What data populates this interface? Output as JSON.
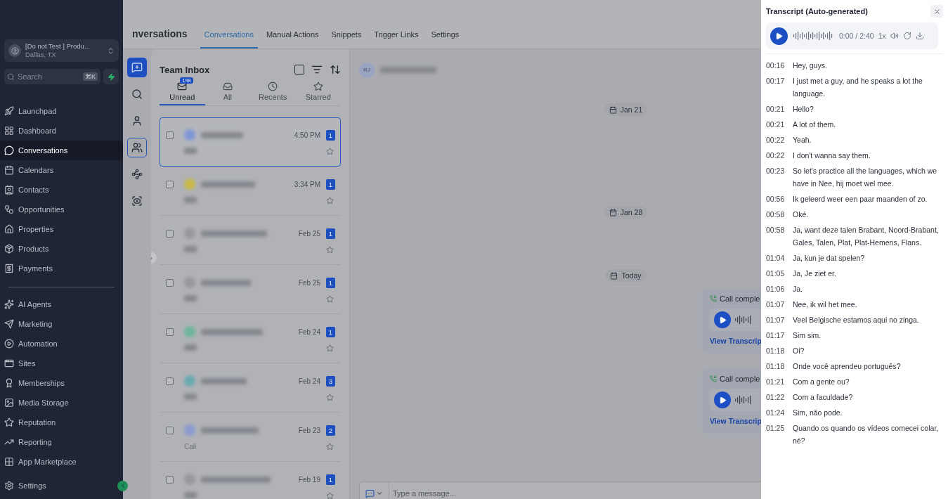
{
  "sidebar": {
    "account": {
      "name": "[Do not Test ] Produ...",
      "location": "Dallas, TX"
    },
    "search": {
      "placeholder": "Search",
      "shortcut": "⌘K"
    },
    "items": [
      {
        "label": "Launchpad",
        "selected": false
      },
      {
        "label": "Dashboard",
        "selected": false
      },
      {
        "label": "Conversations",
        "selected": true
      },
      {
        "label": "Calendars",
        "selected": false
      },
      {
        "label": "Contacts",
        "selected": false
      },
      {
        "label": "Opportunities",
        "selected": false
      },
      {
        "label": "Properties",
        "selected": false
      },
      {
        "label": "Products",
        "selected": false
      },
      {
        "label": "Payments",
        "selected": false
      }
    ],
    "items2": [
      {
        "label": "AI Agents",
        "selected": false
      },
      {
        "label": "Marketing",
        "selected": false
      },
      {
        "label": "Automation",
        "selected": false
      },
      {
        "label": "Sites",
        "selected": false
      },
      {
        "label": "Memberships",
        "selected": false
      },
      {
        "label": "Media Storage",
        "selected": false
      },
      {
        "label": "Reputation",
        "selected": false
      },
      {
        "label": "Reporting",
        "selected": false
      },
      {
        "label": "App Marketplace",
        "selected": false
      }
    ],
    "settings": "Settings"
  },
  "header": {
    "title": "nversations",
    "tabs": [
      {
        "label": "Conversations",
        "selected": true
      },
      {
        "label": "Manual Actions",
        "selected": false
      },
      {
        "label": "Snippets",
        "selected": false
      },
      {
        "label": "Trigger Links",
        "selected": false
      },
      {
        "label": "Settings",
        "selected": false
      }
    ]
  },
  "rail": [
    {
      "selected": false,
      "kind": "primary"
    },
    {
      "selected": false,
      "kind": "plain"
    },
    {
      "selected": false,
      "kind": "plain"
    },
    {
      "selected": true,
      "kind": "plain"
    },
    {
      "selected": false,
      "kind": "plain"
    },
    {
      "selected": false,
      "kind": "plain"
    }
  ],
  "inbox": {
    "title": "Team Inbox",
    "select_all_checked": false,
    "filters": [
      {
        "label": "Unread",
        "badge": "198",
        "selected": true
      },
      {
        "label": "All",
        "selected": false
      },
      {
        "label": "Recents",
        "selected": false
      },
      {
        "label": "Starred",
        "selected": false
      }
    ],
    "rows": [
      {
        "time": "4:50 PM",
        "count": "1",
        "selected": true,
        "color": "#7f97d6"
      },
      {
        "time": "3:34 PM",
        "count": "1",
        "selected": false,
        "color": "#c9b94a"
      },
      {
        "time": "Feb 25",
        "count": "1",
        "selected": false,
        "color": "#98999e"
      },
      {
        "time": "Feb 25",
        "count": "1",
        "selected": false,
        "color": "#98999e"
      },
      {
        "time": "Feb 24",
        "count": "1",
        "selected": false,
        "color": "#6fb59a"
      },
      {
        "time": "Feb 24",
        "count": "3",
        "selected": false,
        "color": "#6aa8b0"
      },
      {
        "time": "Feb 23",
        "count": "2",
        "selected": false,
        "color": "#8b9bd0",
        "preview": "Call"
      },
      {
        "time": "Feb 19",
        "count": "1",
        "selected": false,
        "color": "#98999e"
      }
    ]
  },
  "chat": {
    "avatar": "RJ",
    "items": [
      {
        "kind": "date",
        "label": "Jan 21"
      },
      {
        "kind": "date",
        "label": "Jan 28"
      },
      {
        "kind": "date",
        "label": "Today"
      },
      {
        "kind": "call",
        "label": "Call comple",
        "link": "View Transcrip"
      },
      {
        "kind": "call",
        "label": "Call comple",
        "link": "View Transcrip"
      }
    ],
    "placeholder": "Type a message..."
  },
  "transcript": {
    "title": "Transcript (Auto-generated)",
    "player": {
      "time": "0:00 / 2:40",
      "speed": "1x"
    },
    "lines": [
      {
        "t": "00:16",
        "text": "Hey, guys."
      },
      {
        "t": "00:17",
        "text": "I just met a guy, and he speaks a lot the language."
      },
      {
        "t": "00:21",
        "text": "Hello?"
      },
      {
        "t": "00:21",
        "text": "A lot of them."
      },
      {
        "t": "00:22",
        "text": "Yeah."
      },
      {
        "t": "00:22",
        "text": "I don't wanna say them."
      },
      {
        "t": "00:23",
        "text": "So let's practice all the languages, which we have in Nee, hij moet wel mee."
      },
      {
        "t": "00:56",
        "text": "Ik geleerd weer een paar maanden of zo."
      },
      {
        "t": "00:58",
        "text": "Oké."
      },
      {
        "t": "00:58",
        "text": "Ja, want deze talen Brabant, Noord-Brabant, Gales, Talen, Plat, Plat-Hemens, Flans."
      },
      {
        "t": "01:04",
        "text": "Ja, kun je dat spelen?"
      },
      {
        "t": "01:05",
        "text": "Ja, Je ziet er."
      },
      {
        "t": "01:06",
        "text": "Ja."
      },
      {
        "t": "01:07",
        "text": "Nee, ik wil het mee."
      },
      {
        "t": "01:07",
        "text": "Veel Belgische estamos aqui no zinga."
      },
      {
        "t": "01:17",
        "text": "Sim sim."
      },
      {
        "t": "01:18",
        "text": "Oi?"
      },
      {
        "t": "01:18",
        "text": "Onde você aprendeu português?"
      },
      {
        "t": "01:21",
        "text": "Com a gente ou?"
      },
      {
        "t": "01:22",
        "text": "Com a faculdade?"
      },
      {
        "t": "01:24",
        "text": "Sim, não pode."
      },
      {
        "t": "01:25",
        "text": "Quando os quando os vídeos comecei colar, né?"
      }
    ]
  }
}
